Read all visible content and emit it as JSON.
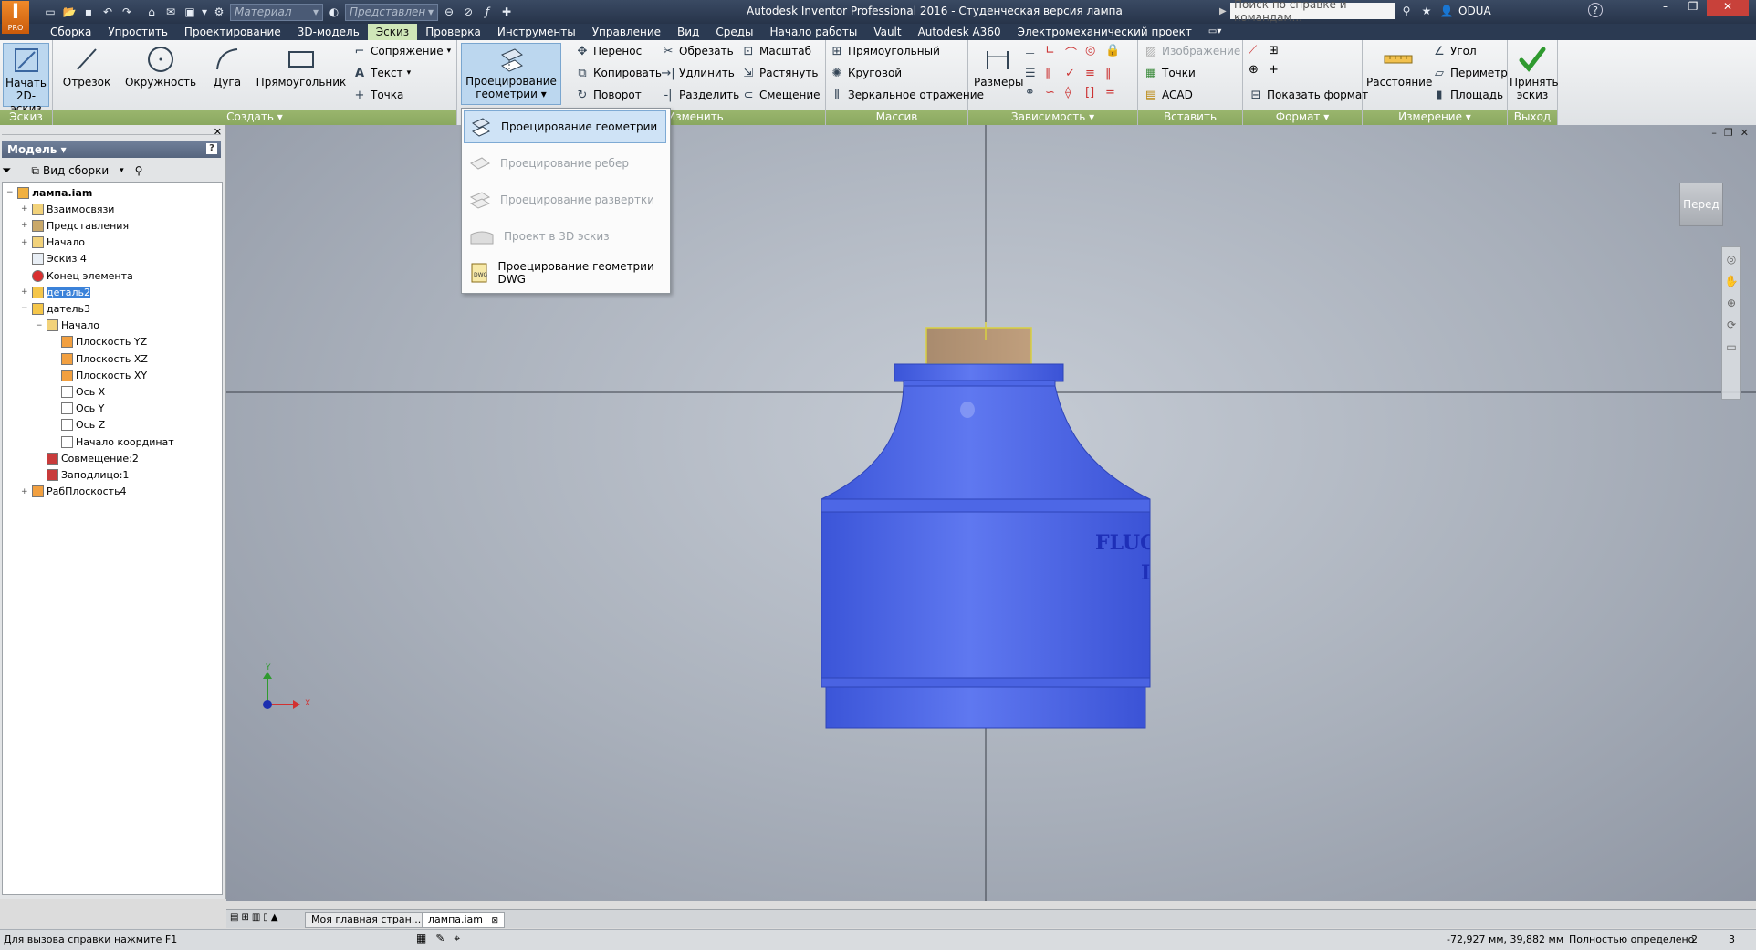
{
  "titlebar": {
    "app_title": "Autodesk Inventor Professional 2016 - Студенческая версия   лампа",
    "material_placeholder": "Материал",
    "representation_placeholder": "Представлен",
    "search_placeholder": "Поиск по справке и командам...",
    "user": "ODUA",
    "logo_letter": "I",
    "logo_sub": "PRO"
  },
  "tabs": [
    "Сборка",
    "Упростить",
    "Проектирование",
    "3D-модель",
    "Эскиз",
    "Проверка",
    "Инструменты",
    "Управление",
    "Вид",
    "Среды",
    "Начало работы",
    "Vault",
    "Autodesk A360",
    "Электромеханический проект"
  ],
  "active_tab": "Эскиз",
  "ribbon": {
    "sketch_panel": {
      "label": "Эскиз",
      "start_line1": "Начать",
      "start_line2": "2D-эскиз"
    },
    "create_panel": {
      "label": "Создать",
      "line": "Отрезок",
      "circle": "Окружность",
      "arc": "Дуга",
      "rect": "Прямоугольник",
      "fillet": "Сопряжение",
      "text": "Текст",
      "point": "Точка",
      "project_line1": "Проецирование",
      "project_line2": "геометрии"
    },
    "modify_panel": {
      "label": "Изменить",
      "move": "Перенос",
      "copy": "Копировать",
      "rotate": "Поворот",
      "trim": "Обрезать",
      "extend": "Удлинить",
      "split": "Разделить",
      "scale": "Масштаб",
      "stretch": "Растянуть",
      "offset": "Смещение"
    },
    "pattern_panel": {
      "label": "Массив",
      "rect": "Прямоугольный",
      "circ": "Круговой",
      "mirror": "Зеркальное отражение"
    },
    "constrain_panel": {
      "label": "Зависимость",
      "dims": "Размеры"
    },
    "insert_panel": {
      "label": "Вставить",
      "image": "Изображение",
      "points": "Точки",
      "acad": "ACAD"
    },
    "format_panel": {
      "label": "Формат",
      "show_format": "Показать формат"
    },
    "measure_panel": {
      "label": "Измерение",
      "distance": "Расстояние",
      "angle": "Угол",
      "perimeter": "Периметр",
      "area": "Площадь"
    },
    "exit_panel": {
      "label": "Выход",
      "accept_line1": "Принять",
      "accept_line2": "эскиз"
    }
  },
  "dropdown": {
    "items": [
      "Проецирование геометрии",
      "Проецирование ребер",
      "Проецирование развертки",
      "Проект в 3D эскиз",
      "Проецирование геометрии DWG"
    ]
  },
  "browser": {
    "title": "Модель",
    "view_label": "Вид сборки",
    "tree": [
      {
        "label": "лампа.iam",
        "bold": true
      },
      {
        "label": "Взаимосвязи"
      },
      {
        "label": "Представления"
      },
      {
        "label": "Начало"
      },
      {
        "label": "Эскиз 4"
      },
      {
        "label": "Конец элемента"
      },
      {
        "label": "деталь2"
      },
      {
        "label": "датель3"
      },
      {
        "label": "Начало"
      },
      {
        "label": "Плоскость YZ"
      },
      {
        "label": "Плоскость XZ"
      },
      {
        "label": "Плоскость XY"
      },
      {
        "label": "Ось X"
      },
      {
        "label": "Ось Y"
      },
      {
        "label": "Ось Z"
      },
      {
        "label": "Начало координат"
      },
      {
        "label": "Совмещение:2"
      },
      {
        "label": "Заподлицо:1"
      },
      {
        "label": "РабПлоскость4"
      }
    ]
  },
  "viewport": {
    "viewcube_label": "Перед",
    "model_text1": "FLUO",
    "model_text2": "I",
    "axis_x": "X",
    "axis_y": "Y"
  },
  "doc_tabs": [
    "Моя главная стран...",
    "лампа.iam"
  ],
  "status": {
    "help": "Для вызова справки нажмите F1",
    "coords": "-72,927 мм, 39,882 мм",
    "state": "Полностью определено",
    "n1": "2",
    "n2": "3"
  }
}
